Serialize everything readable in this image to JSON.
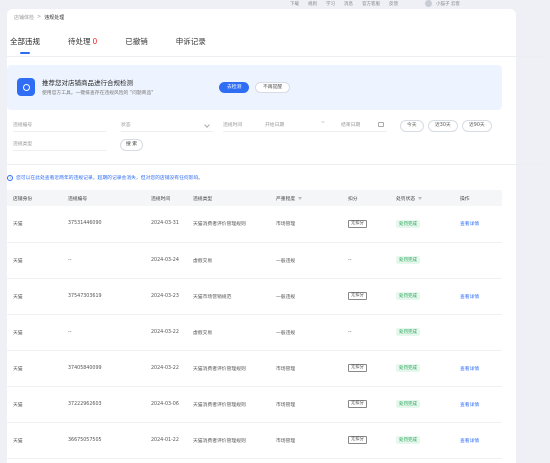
{
  "topnav": {
    "links": [
      "下载",
      "规则",
      "学习",
      "消息",
      "官方客服",
      "反馈"
    ],
    "username": "小猫子 云客"
  },
  "breadcrumb": {
    "parent": "店铺体检",
    "sep": ">",
    "current": "违规处理"
  },
  "tabs": [
    {
      "label": "全部违规",
      "count": ""
    },
    {
      "label": "待处理",
      "count": "0"
    },
    {
      "label": "已撤销",
      "count": ""
    },
    {
      "label": "申诉记录",
      "count": ""
    }
  ],
  "banner": {
    "title": "推荐您对店铺商品进行合规检测",
    "subtitle": "使用官方工具，一键排查存在违规风险的 \"问题商品\"",
    "primary_button": "去检测",
    "secondary_button": "不再提醒"
  },
  "filters": {
    "violation_no_placeholder": "违规编号",
    "status_placeholder": "状态",
    "time_label": "违规时间",
    "start_placeholder": "开始日期",
    "range_sep": "~",
    "end_placeholder": "结束日期",
    "quick_ranges": [
      "今天",
      "近30天",
      "近90天"
    ],
    "type_placeholder": "违规类型",
    "search_button": "搜 索"
  },
  "notice": "您可以在此处查看近两年的违规记录，超期的记录会消失，但对您的店铺没有任何影响。",
  "table": {
    "headers": [
      "店铺身份",
      "违规编号",
      "违规时间",
      "违规类型",
      "严重程度",
      "扣分",
      "处罚状态",
      "操作"
    ],
    "rows": [
      {
        "store": "天猫",
        "no": "37531446090",
        "time": "2024-03-31",
        "type": "天猫消费者评价管理规则",
        "severity": "市场管理",
        "points": "无扣分",
        "state": "处罚完成",
        "op": "查看详情"
      },
      {
        "store": "天猫",
        "no": "--",
        "time": "2024-03-24",
        "type": "虚假交易",
        "severity": "一般违规",
        "points": "--",
        "state": "处罚完成",
        "op": ""
      },
      {
        "store": "天猫",
        "no": "37547303619",
        "time": "2024-03-23",
        "type": "天猫市场营销规范",
        "severity": "一般违规",
        "points": "无扣分",
        "state": "处罚完成",
        "op": "查看详情"
      },
      {
        "store": "天猫",
        "no": "--",
        "time": "2024-03-22",
        "type": "虚假交易",
        "severity": "一般违规",
        "points": "--",
        "state": "处罚完成",
        "op": ""
      },
      {
        "store": "天猫",
        "no": "37405840099",
        "time": "2024-03-22",
        "type": "天猫消费者评价管理规则",
        "severity": "市场管理",
        "points": "无扣分",
        "state": "处罚完成",
        "op": "查看详情"
      },
      {
        "store": "天猫",
        "no": "37222962603",
        "time": "2024-03-06",
        "type": "天猫消费者评价管理规则",
        "severity": "市场管理",
        "points": "无扣分",
        "state": "处罚完成",
        "op": "查看详情"
      },
      {
        "store": "天猫",
        "no": "36675057505",
        "time": "2024-01-22",
        "type": "天猫消费者评价管理规则",
        "severity": "市场管理",
        "points": "无扣分",
        "state": "处罚完成",
        "op": "查看详情"
      }
    ]
  },
  "colors": {
    "accent": "#2f6df5",
    "success": "#28a65a",
    "danger": "#f5222d"
  }
}
